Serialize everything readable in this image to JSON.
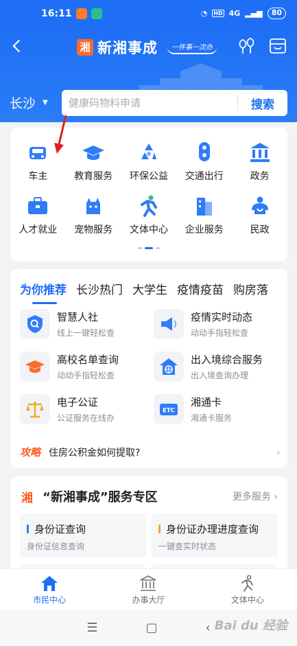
{
  "status_bar": {
    "time": "16:11",
    "net": "4G",
    "battery": "80"
  },
  "header": {
    "app_name": "新湘事成",
    "logo_char": "湘",
    "slogan": "一件事一次办",
    "city": "长沙",
    "search_placeholder": "健康码物料申请",
    "search_button": "搜索"
  },
  "services": [
    {
      "label": "车主",
      "icon": "car-icon"
    },
    {
      "label": "教育服务",
      "icon": "graduation-cap-icon"
    },
    {
      "label": "环保公益",
      "icon": "recycle-icon"
    },
    {
      "label": "交通出行",
      "icon": "traffic-light-icon"
    },
    {
      "label": "政务",
      "icon": "government-building-icon"
    },
    {
      "label": "人才就业",
      "icon": "briefcase-icon"
    },
    {
      "label": "宠物服务",
      "icon": "pet-icon"
    },
    {
      "label": "文体中心",
      "icon": "runner-icon"
    },
    {
      "label": "企业服务",
      "icon": "office-building-icon"
    },
    {
      "label": "民政",
      "icon": "people-icon"
    }
  ],
  "recommend": {
    "tabs": [
      "为你推荐",
      "长沙热门",
      "大学生",
      "疫情疫苗",
      "购房落"
    ],
    "items": [
      {
        "title": "智慧人社",
        "subtitle": "线上一键轻松查",
        "icon": "shield-search-icon",
        "color": "#2f7cf6"
      },
      {
        "title": "疫情实时动态",
        "subtitle": "动动手指轻松查",
        "icon": "megaphone-icon",
        "color": "#2f7cf6"
      },
      {
        "title": "高校名单查询",
        "subtitle": "动动手指轻松查",
        "icon": "graduation-cap-icon",
        "color": "#ff6a2a"
      },
      {
        "title": "出入境综合服务",
        "subtitle": "出入境查询办理",
        "icon": "globe-house-icon",
        "color": "#2f7cf6"
      },
      {
        "title": "电子公证",
        "subtitle": "公证服务在线办",
        "icon": "scales-icon",
        "color": "#f5a623"
      },
      {
        "title": "湘通卡",
        "subtitle": "湘通卡服务",
        "icon": "etc-card-icon",
        "color": "#2f7cf6"
      }
    ],
    "tip_tag": "攻略",
    "tip_text": "住房公积金如何提取?"
  },
  "zone": {
    "logo_char": "湘",
    "title": "“新湘事成”服务专区",
    "more": "更多服务",
    "items": [
      {
        "title": "身份证查询",
        "subtitle": "身份证信息查询",
        "color": "#2f7cf6"
      },
      {
        "title": "身份证办理进度查询",
        "subtitle": "一键查实时状态",
        "color": "#f5a623"
      }
    ]
  },
  "bottom_nav": [
    {
      "label": "市民中心",
      "icon": "home-icon"
    },
    {
      "label": "办事大厅",
      "icon": "hall-icon"
    },
    {
      "label": "文体中心",
      "icon": "runner-icon"
    }
  ],
  "colors": {
    "primary": "#1e6ff5",
    "accent": "#ff5a1f",
    "annotation": "#e02020"
  }
}
